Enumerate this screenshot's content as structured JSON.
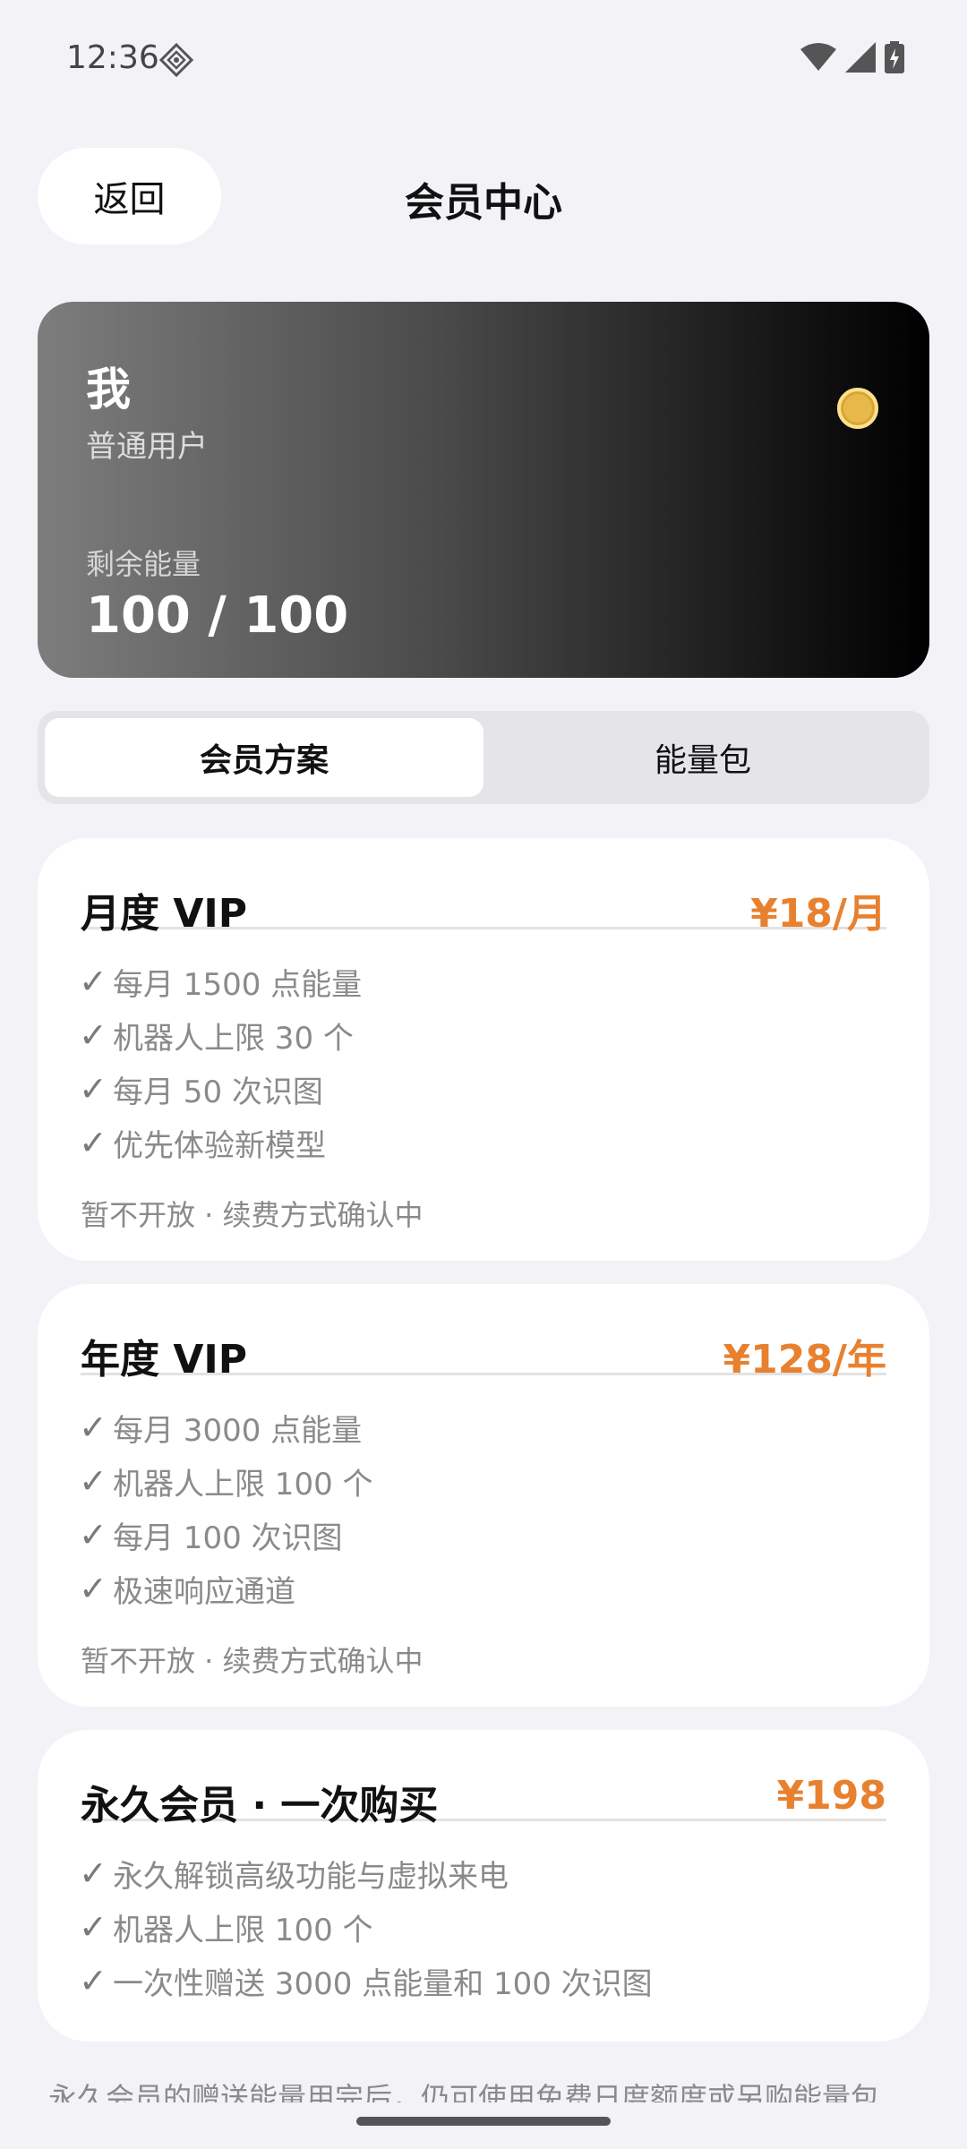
{
  "status_bar": {
    "time": "12:36",
    "icons": [
      "shield-icon",
      "wifi-icon",
      "cell-signal-icon",
      "battery-icon"
    ]
  },
  "header": {
    "back_label": "返回",
    "title": "会员中心"
  },
  "member_card": {
    "name": "我",
    "level": "普通用户",
    "energy_label": "剩余能量",
    "energy_value": "100 / 100",
    "gradient": [
      "#7d7d7d",
      "#000000"
    ],
    "coin_color": "#e8b84a"
  },
  "tabs": [
    {
      "label": "会员方案",
      "active": true
    },
    {
      "label": "能量包",
      "active": false
    }
  ],
  "plans": [
    {
      "name": "月度 VIP",
      "price": "¥18/月",
      "features": [
        "每月 1500 点能量",
        "机器人上限 30 个",
        "每月 50 次识图",
        "优先体验新模型"
      ],
      "note": "暂不开放 · 续费方式确认中"
    },
    {
      "name": "年度 VIP",
      "price": "¥128/年",
      "features": [
        "每月 3000 点能量",
        "机器人上限 100 个",
        "每月 100 次识图",
        "极速响应通道"
      ],
      "note": "暂不开放 · 续费方式确认中"
    },
    {
      "name": "永久会员 · 一次购买",
      "price": "¥198",
      "features": [
        "永久解锁高级功能与虚拟来电",
        "机器人上限 100 个",
        "一次性赠送 3000 点能量和 100 次识图"
      ]
    }
  ],
  "check_mark": "✓",
  "footer_text": "永久会员的赠送能量用完后，仍可使用免费日度额度或另购能量包",
  "colors": {
    "accent_price": "#e8812f",
    "background": "#f2f2f7"
  }
}
